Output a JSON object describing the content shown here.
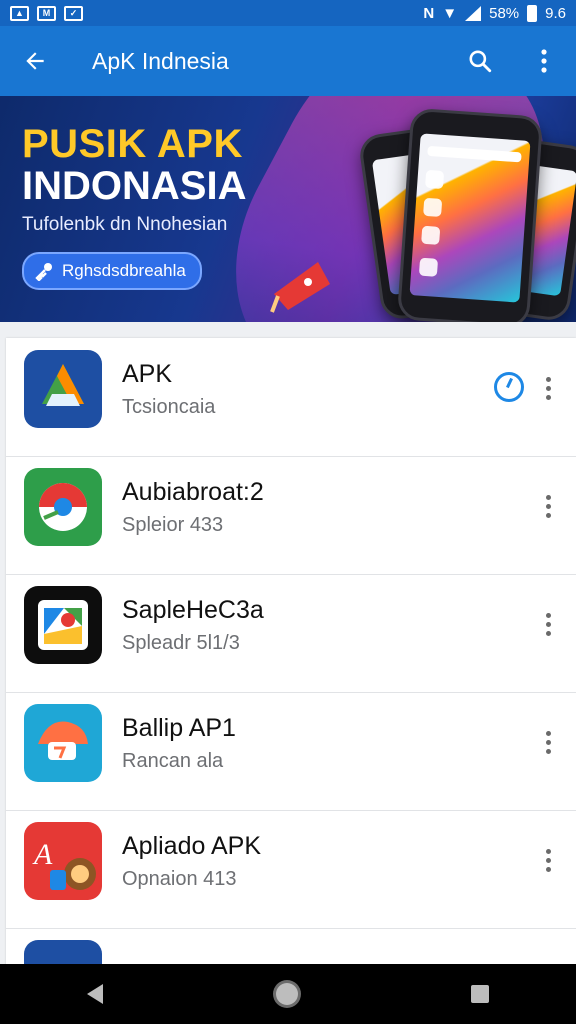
{
  "status_bar": {
    "right_text": "58%",
    "time": "9.6"
  },
  "app_bar": {
    "title": "ApK Indnesia"
  },
  "banner": {
    "title_line1": "PUSIK APK",
    "title_line2": "INDONASIA",
    "subtitle": "Tufolenbk dn Nnohesian",
    "button_label": "Rghsdsdbreahla"
  },
  "apps": [
    {
      "name": "APK",
      "meta": "Tcsioncaia",
      "has_status_icon": true
    },
    {
      "name": "Aubiabroat:2",
      "meta": "Spleior 433"
    },
    {
      "name": "SapleHeC3a",
      "meta": "Spleadr 5l1/3"
    },
    {
      "name": "Ballip AP1",
      "meta": "Rancan ala"
    },
    {
      "name": "Apliado APK",
      "meta": "Opnaion 413"
    }
  ],
  "colors": {
    "status_bar": "#1565c0",
    "app_bar": "#1976d2",
    "banner_yellow": "#ffc928",
    "accent": "#1e88e5"
  }
}
